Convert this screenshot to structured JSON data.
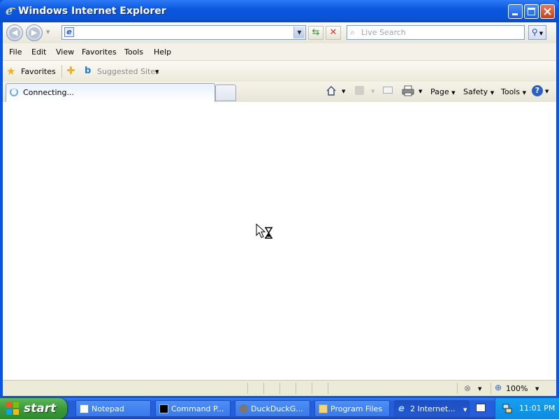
{
  "window": {
    "title": "Windows Internet Explorer"
  },
  "address": {
    "value": ""
  },
  "search": {
    "placeholder": "Live Search"
  },
  "menu": [
    "File",
    "Edit",
    "View",
    "Favorites",
    "Tools",
    "Help"
  ],
  "favorites_bar": {
    "favorites_label": "Favorites",
    "suggested_label": "Suggested Sites"
  },
  "tab": {
    "title": "Connecting..."
  },
  "command_bar": {
    "page_label": "Page",
    "safety_label": "Safety",
    "tools_label": "Tools"
  },
  "status": {
    "zoom": "100%"
  },
  "taskbar": {
    "start_label": "start",
    "items": [
      {
        "label": "Notepad"
      },
      {
        "label": "Command P..."
      },
      {
        "label": "DuckDuckG..."
      },
      {
        "label": "Program Files"
      },
      {
        "label": "2 Internet..."
      }
    ],
    "clock": "11:01 PM"
  },
  "colors": {
    "titlebar": "#0b58e0",
    "taskbar": "#245edb",
    "start": "#3a9a3b",
    "tray": "#0e8ae0"
  }
}
